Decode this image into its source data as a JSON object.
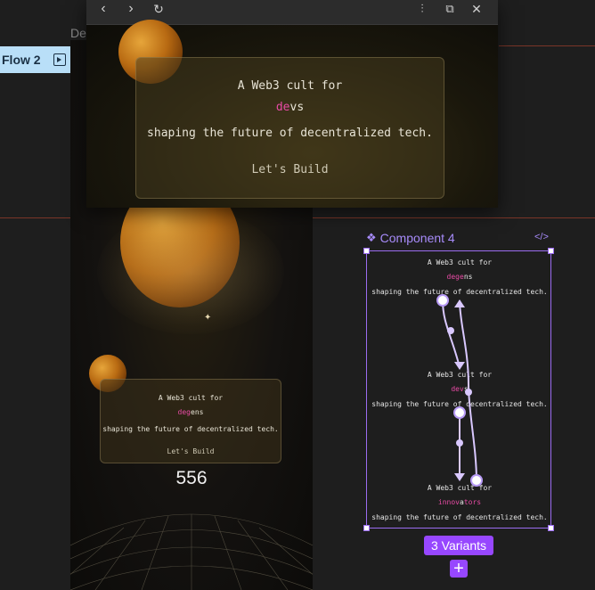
{
  "canvas": {
    "frame_label": "De",
    "flow_label": "Flow 2"
  },
  "preview_window": {
    "line1": "A Web3 cult for",
    "word_pink": "de",
    "word_rest": "vs",
    "line3": "shaping the future of decentralized tech.",
    "cta": "Let's Build"
  },
  "frame_card": {
    "line1": "A Web3 cult for",
    "word_pink": "deg",
    "word_rest": "ens",
    "line3": "shaping the future of decentralized tech.",
    "cta": "Let's Build",
    "counter": "556"
  },
  "component": {
    "title": "Component 4",
    "variants": [
      {
        "line1": "A Web3 cult for",
        "word_pink": "deg",
        "word_mid": "e",
        "word_rest": "ns",
        "line3": "shaping the future of decentralized tech."
      },
      {
        "line1": "A Web3 cult for",
        "word_pink": "dev",
        "word_mid": "",
        "word_rest": "s",
        "line3": "shaping the future of decentralized tech."
      },
      {
        "line1": "A Web3 cult for",
        "word_pink": "innov",
        "word_mid": "a",
        "word_rest": "tors",
        "line3": "shaping the future of decentralized tech."
      }
    ],
    "variants_badge": "3 Variants",
    "add_label": "+"
  },
  "icons": [
    "back-icon",
    "forward-icon",
    "reload-icon",
    "settings-sliders-icon",
    "open-external-icon",
    "close-icon",
    "play-frame-icon",
    "component-icon",
    "code-icon"
  ]
}
